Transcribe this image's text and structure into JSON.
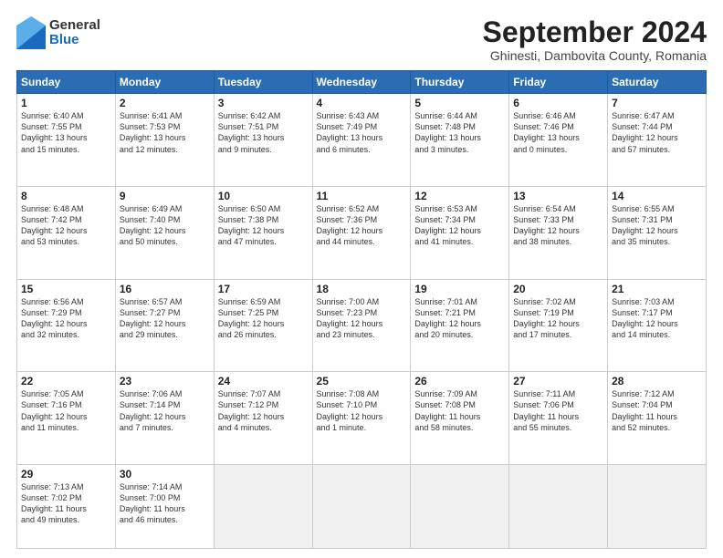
{
  "logo": {
    "general": "General",
    "blue": "Blue"
  },
  "title": "September 2024",
  "subtitle": "Ghinesti, Dambovita County, Romania",
  "headers": [
    "Sunday",
    "Monday",
    "Tuesday",
    "Wednesday",
    "Thursday",
    "Friday",
    "Saturday"
  ],
  "weeks": [
    [
      {
        "day": "1",
        "info": "Sunrise: 6:40 AM\nSunset: 7:55 PM\nDaylight: 13 hours\nand 15 minutes."
      },
      {
        "day": "2",
        "info": "Sunrise: 6:41 AM\nSunset: 7:53 PM\nDaylight: 13 hours\nand 12 minutes."
      },
      {
        "day": "3",
        "info": "Sunrise: 6:42 AM\nSunset: 7:51 PM\nDaylight: 13 hours\nand 9 minutes."
      },
      {
        "day": "4",
        "info": "Sunrise: 6:43 AM\nSunset: 7:49 PM\nDaylight: 13 hours\nand 6 minutes."
      },
      {
        "day": "5",
        "info": "Sunrise: 6:44 AM\nSunset: 7:48 PM\nDaylight: 13 hours\nand 3 minutes."
      },
      {
        "day": "6",
        "info": "Sunrise: 6:46 AM\nSunset: 7:46 PM\nDaylight: 13 hours\nand 0 minutes."
      },
      {
        "day": "7",
        "info": "Sunrise: 6:47 AM\nSunset: 7:44 PM\nDaylight: 12 hours\nand 57 minutes."
      }
    ],
    [
      {
        "day": "8",
        "info": "Sunrise: 6:48 AM\nSunset: 7:42 PM\nDaylight: 12 hours\nand 53 minutes."
      },
      {
        "day": "9",
        "info": "Sunrise: 6:49 AM\nSunset: 7:40 PM\nDaylight: 12 hours\nand 50 minutes."
      },
      {
        "day": "10",
        "info": "Sunrise: 6:50 AM\nSunset: 7:38 PM\nDaylight: 12 hours\nand 47 minutes."
      },
      {
        "day": "11",
        "info": "Sunrise: 6:52 AM\nSunset: 7:36 PM\nDaylight: 12 hours\nand 44 minutes."
      },
      {
        "day": "12",
        "info": "Sunrise: 6:53 AM\nSunset: 7:34 PM\nDaylight: 12 hours\nand 41 minutes."
      },
      {
        "day": "13",
        "info": "Sunrise: 6:54 AM\nSunset: 7:33 PM\nDaylight: 12 hours\nand 38 minutes."
      },
      {
        "day": "14",
        "info": "Sunrise: 6:55 AM\nSunset: 7:31 PM\nDaylight: 12 hours\nand 35 minutes."
      }
    ],
    [
      {
        "day": "15",
        "info": "Sunrise: 6:56 AM\nSunset: 7:29 PM\nDaylight: 12 hours\nand 32 minutes."
      },
      {
        "day": "16",
        "info": "Sunrise: 6:57 AM\nSunset: 7:27 PM\nDaylight: 12 hours\nand 29 minutes."
      },
      {
        "day": "17",
        "info": "Sunrise: 6:59 AM\nSunset: 7:25 PM\nDaylight: 12 hours\nand 26 minutes."
      },
      {
        "day": "18",
        "info": "Sunrise: 7:00 AM\nSunset: 7:23 PM\nDaylight: 12 hours\nand 23 minutes."
      },
      {
        "day": "19",
        "info": "Sunrise: 7:01 AM\nSunset: 7:21 PM\nDaylight: 12 hours\nand 20 minutes."
      },
      {
        "day": "20",
        "info": "Sunrise: 7:02 AM\nSunset: 7:19 PM\nDaylight: 12 hours\nand 17 minutes."
      },
      {
        "day": "21",
        "info": "Sunrise: 7:03 AM\nSunset: 7:17 PM\nDaylight: 12 hours\nand 14 minutes."
      }
    ],
    [
      {
        "day": "22",
        "info": "Sunrise: 7:05 AM\nSunset: 7:16 PM\nDaylight: 12 hours\nand 11 minutes."
      },
      {
        "day": "23",
        "info": "Sunrise: 7:06 AM\nSunset: 7:14 PM\nDaylight: 12 hours\nand 7 minutes."
      },
      {
        "day": "24",
        "info": "Sunrise: 7:07 AM\nSunset: 7:12 PM\nDaylight: 12 hours\nand 4 minutes."
      },
      {
        "day": "25",
        "info": "Sunrise: 7:08 AM\nSunset: 7:10 PM\nDaylight: 12 hours\nand 1 minute."
      },
      {
        "day": "26",
        "info": "Sunrise: 7:09 AM\nSunset: 7:08 PM\nDaylight: 11 hours\nand 58 minutes."
      },
      {
        "day": "27",
        "info": "Sunrise: 7:11 AM\nSunset: 7:06 PM\nDaylight: 11 hours\nand 55 minutes."
      },
      {
        "day": "28",
        "info": "Sunrise: 7:12 AM\nSunset: 7:04 PM\nDaylight: 11 hours\nand 52 minutes."
      }
    ],
    [
      {
        "day": "29",
        "info": "Sunrise: 7:13 AM\nSunset: 7:02 PM\nDaylight: 11 hours\nand 49 minutes."
      },
      {
        "day": "30",
        "info": "Sunrise: 7:14 AM\nSunset: 7:00 PM\nDaylight: 11 hours\nand 46 minutes."
      },
      {
        "day": "",
        "info": ""
      },
      {
        "day": "",
        "info": ""
      },
      {
        "day": "",
        "info": ""
      },
      {
        "day": "",
        "info": ""
      },
      {
        "day": "",
        "info": ""
      }
    ]
  ]
}
